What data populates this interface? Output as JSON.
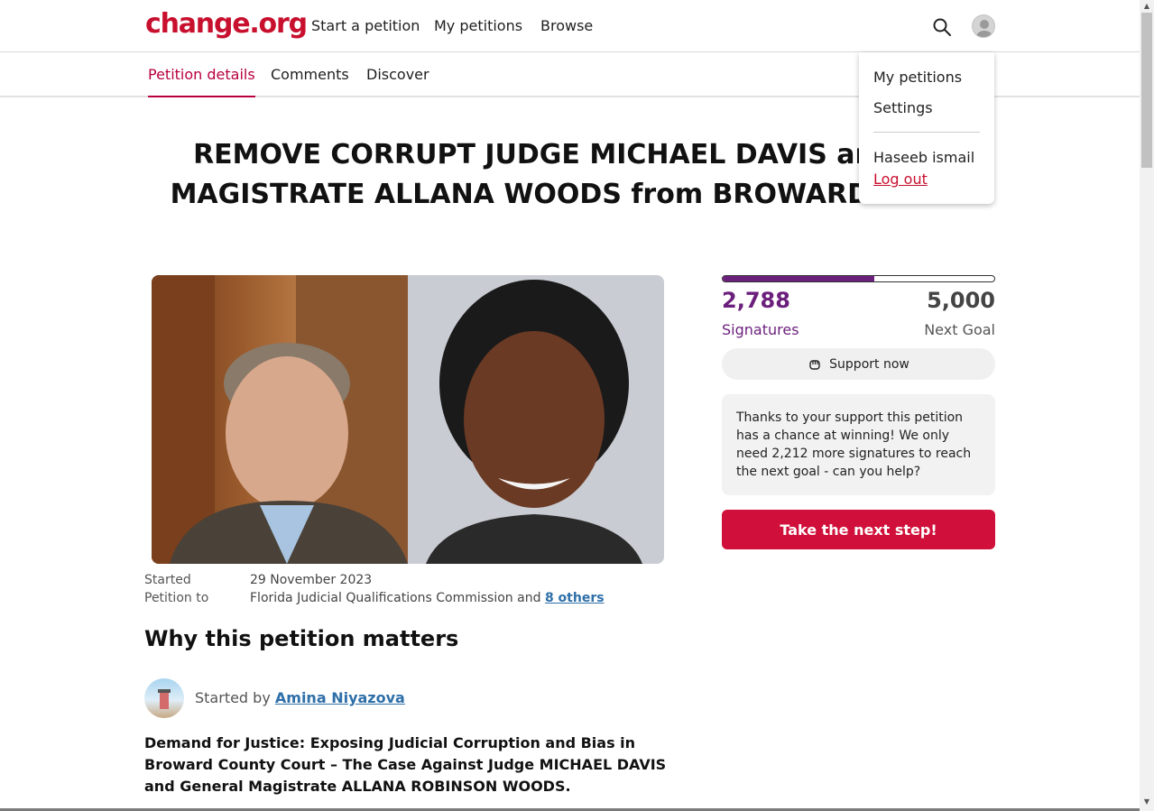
{
  "brand": {
    "logo": "change.org",
    "accent": "#c8102e",
    "purple": "#6b1f7c"
  },
  "nav": {
    "links": [
      "Start a petition",
      "My petitions",
      "Browse"
    ],
    "search_icon": "search-icon",
    "avatar_icon": "user-avatar-icon"
  },
  "tabs": [
    "Petition details",
    "Comments",
    "Discover"
  ],
  "petition": {
    "title_line1": "REMOVE CORRUPT JUDGE MICHAEL DAVIS and GE",
    "title_line2": "MAGISTRATE ALLANA WOODS from BROWARD COUN",
    "started_label": "Started",
    "started_value": "29 November 2023",
    "petition_to_label": "Petition to",
    "petition_to_value": "Florida Judicial Qualifications Commission and",
    "petition_to_link": "8 others",
    "why_heading": "Why this petition matters",
    "started_by_prefix": "Started by",
    "starter_name": "Amina Niyazova",
    "body": "Demand for Justice: Exposing Judicial Corruption and Bias in Broward County Court – The Case Against Judge MICHAEL DAVIS and General Magistrate ALLANA ROBINSON WOODS."
  },
  "progress": {
    "fraction": 0.5576,
    "signatures": "2,788",
    "signatures_label": "Signatures",
    "goal": "5,000",
    "goal_label": "Next Goal"
  },
  "support_button": "Support now",
  "info_text": "Thanks to your support this petition has a chance at winning! We only need 2,212 more signatures to reach the next goal - can you help?",
  "next_step_button": "Take the next step!",
  "dropdown": {
    "items": [
      "My petitions",
      "Settings"
    ],
    "user_name": "Haseeb ismail",
    "logout": "Log out"
  }
}
